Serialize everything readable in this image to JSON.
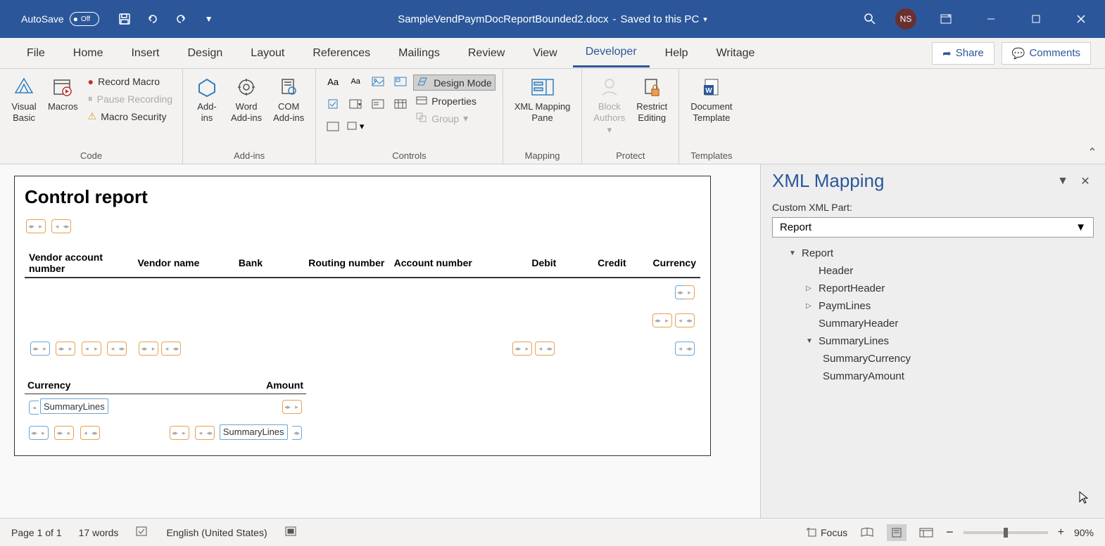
{
  "titlebar": {
    "autosave_label": "AutoSave",
    "autosave_state": "Off",
    "doc_name": "SampleVendPaymDocReportBounded2.docx",
    "save_status": "Saved to this PC",
    "user_initials": "NS"
  },
  "tabs": {
    "file": "File",
    "home": "Home",
    "insert": "Insert",
    "design": "Design",
    "layout": "Layout",
    "references": "References",
    "mailings": "Mailings",
    "review": "Review",
    "view": "View",
    "developer": "Developer",
    "help": "Help",
    "writage": "Writage",
    "share": "Share",
    "comments": "Comments"
  },
  "ribbon": {
    "code": {
      "visual_basic": "Visual\nBasic",
      "macros": "Macros",
      "record_macro": "Record Macro",
      "pause_recording": "Pause Recording",
      "macro_security": "Macro Security",
      "label": "Code"
    },
    "addins": {
      "addins_btn": "Add-\nins",
      "word_addins": "Word\nAdd-ins",
      "com_addins": "COM\nAdd-ins",
      "label": "Add-ins"
    },
    "controls": {
      "design_mode": "Design Mode",
      "properties": "Properties",
      "group": "Group",
      "label": "Controls"
    },
    "mapping": {
      "xml_mapping_pane": "XML Mapping\nPane",
      "label": "Mapping"
    },
    "protect": {
      "block_authors": "Block\nAuthors",
      "restrict_editing": "Restrict\nEditing",
      "label": "Protect"
    },
    "templates": {
      "document_template": "Document\nTemplate",
      "label": "Templates"
    }
  },
  "document": {
    "title": "Control report",
    "table1_headers": {
      "vendor_account": "Vendor account number",
      "vendor_name": "Vendor name",
      "bank": "Bank",
      "routing": "Routing number",
      "account": "Account number",
      "debit": "Debit",
      "credit": "Credit",
      "currency": "Currency"
    },
    "table2_headers": {
      "currency": "Currency",
      "amount": "Amount"
    },
    "summary_lines_tag": "SummaryLines"
  },
  "pane": {
    "title": "XML Mapping",
    "custom_xml_label": "Custom XML Part:",
    "selected_part": "Report",
    "tree": {
      "report": "Report",
      "header": "Header",
      "report_header": "ReportHeader",
      "paym_lines": "PaymLines",
      "summary_header": "SummaryHeader",
      "summary_lines": "SummaryLines",
      "summary_currency": "SummaryCurrency",
      "summary_amount": "SummaryAmount"
    }
  },
  "statusbar": {
    "page": "Page 1 of 1",
    "words": "17 words",
    "language": "English (United States)",
    "focus": "Focus",
    "zoom": "90%"
  }
}
